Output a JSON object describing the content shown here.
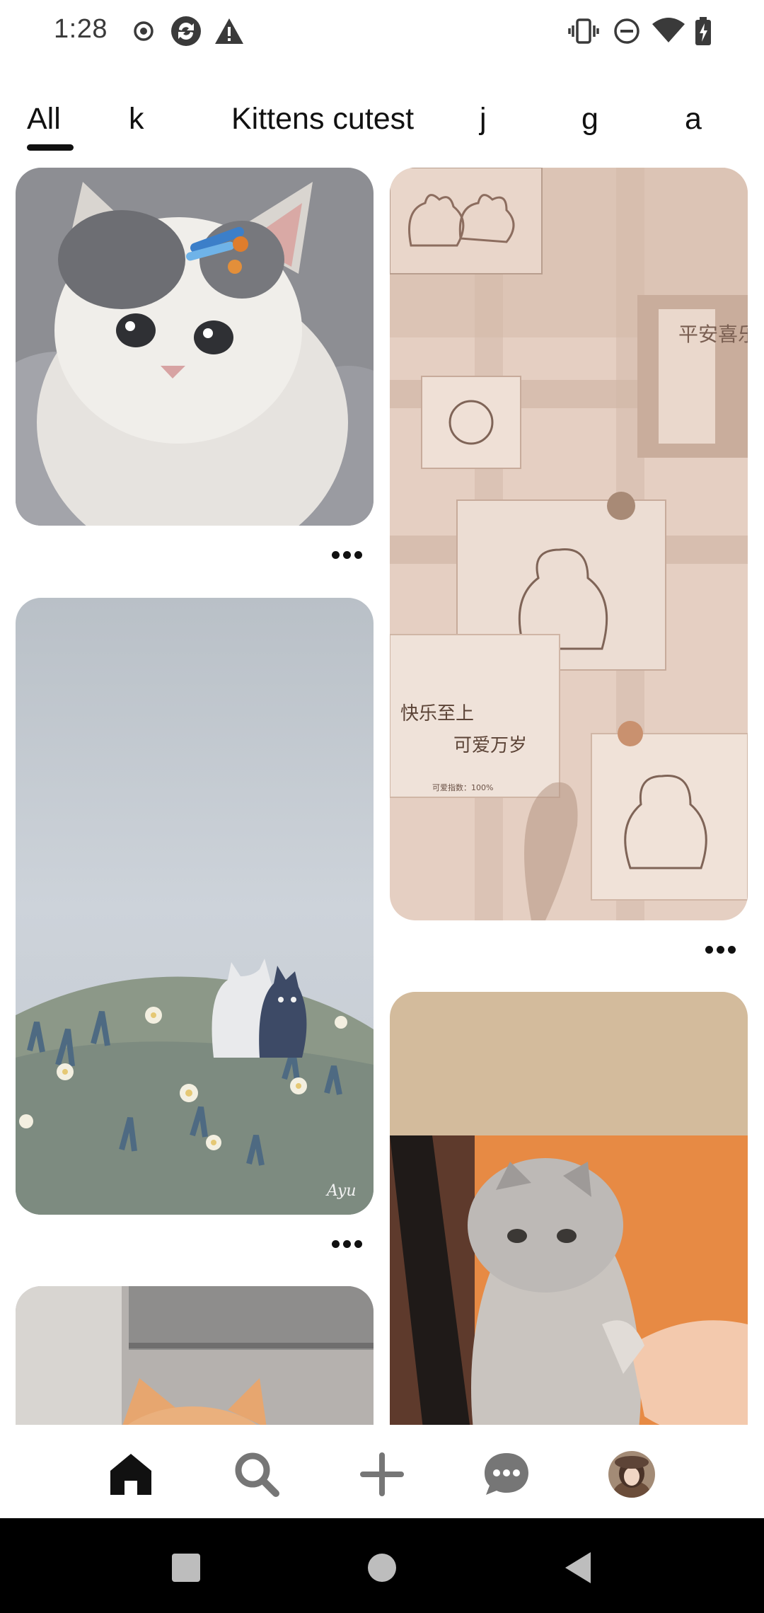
{
  "status_bar": {
    "time": "1:28",
    "left_icons": [
      "record-icon",
      "sync-icon",
      "warning-icon"
    ],
    "right_icons": [
      "vibrate-icon",
      "do-not-disturb-icon",
      "wifi-icon",
      "battery-charging-icon"
    ]
  },
  "tabs": [
    {
      "label": "All",
      "selected": true
    },
    {
      "label": "k",
      "selected": false
    },
    {
      "label": "Kittens cutest",
      "selected": false
    },
    {
      "label": "j",
      "selected": false
    },
    {
      "label": "g",
      "selected": false
    },
    {
      "label": "a",
      "selected": false
    }
  ],
  "pins": {
    "left": [
      {
        "description": "fluffy kitten with hair clips"
      },
      {
        "description": "illustrated cats on flower hill",
        "signature": "Ayu"
      },
      {
        "description": "orange kitten (partially visible)"
      }
    ],
    "right": [
      {
        "description": "pastel bear sketches wallpaper",
        "texts": [
          "平安喜乐",
          "快乐至上",
          "可爱万岁",
          "可爱指数：100%"
        ]
      },
      {
        "description": "grey kitten holding hand"
      }
    ]
  },
  "bottom_nav": [
    {
      "icon": "home-icon",
      "active": true
    },
    {
      "icon": "search-icon",
      "active": false
    },
    {
      "icon": "plus-icon",
      "active": false
    },
    {
      "icon": "chat-icon",
      "active": false
    },
    {
      "icon": "profile-avatar",
      "active": false
    }
  ],
  "system_nav": [
    "recents-icon",
    "home-circle-icon",
    "back-icon"
  ],
  "colors": {
    "text": "#111111",
    "pin_beige": "#e7d2c4",
    "pin_tan": "#d3bb9c",
    "sky": "#c8cfd8"
  }
}
